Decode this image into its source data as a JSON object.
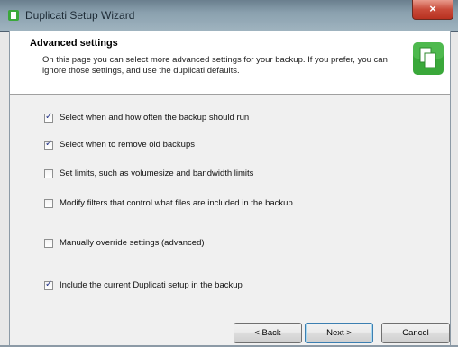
{
  "window": {
    "title": "Duplicati Setup Wizard",
    "close_symbol": "×"
  },
  "header": {
    "title": "Advanced settings",
    "description": "On this page you can select more advanced settings for your backup. If you prefer, you can ignore those settings, and use the duplicati defaults."
  },
  "options": [
    {
      "label": "Select when and how often the backup should run",
      "checked": true
    },
    {
      "label": "Select when to remove old backups",
      "checked": true
    },
    {
      "label": "Set limits, such as volumesize and bandwidth limits",
      "checked": false
    },
    {
      "label": "Modify filters that control what files are included in the backup",
      "checked": false
    },
    {
      "label": "Manually override settings (advanced)",
      "checked": false
    },
    {
      "label": "Include the current Duplicati setup in the backup",
      "checked": true
    }
  ],
  "buttons": {
    "back": "< Back",
    "next": "Next >",
    "cancel": "Cancel"
  },
  "colors": {
    "accent_green": "#3aa83a",
    "close_red": "#c94a39",
    "check_blue": "#2b3a8c"
  },
  "icons": {
    "title": "duplicati-app-icon",
    "header": "duplicati-copy-icon"
  }
}
